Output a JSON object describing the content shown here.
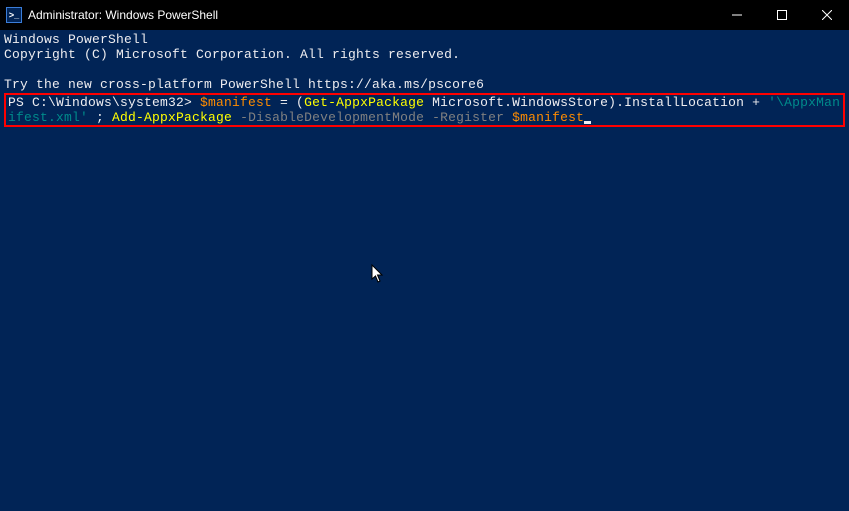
{
  "titlebar": {
    "icon_label": ">_",
    "title": "Administrator: Windows PowerShell"
  },
  "terminal": {
    "header_line1": "Windows PowerShell",
    "header_line2": "Copyright (C) Microsoft Corporation. All rights reserved.",
    "try_line": "Try the new cross-platform PowerShell https://aka.ms/pscore6",
    "prompt": "PS C:\\Windows\\system32> ",
    "cmd": {
      "var_manifest": "$manifest",
      "assign": " = (",
      "get_appx": "Get-AppxPackage",
      "pkg": " Microsoft.WindowsStore).InstallLocation ",
      "plus": "+ ",
      "path_str": "'\\AppxManifest.xml'",
      "sep": " ; ",
      "add_appx": "Add-AppxPackage",
      "param_disable": " -DisableDevelopmentMode",
      "param_register": " -Register",
      "var_manifest2": " $manifest"
    }
  }
}
